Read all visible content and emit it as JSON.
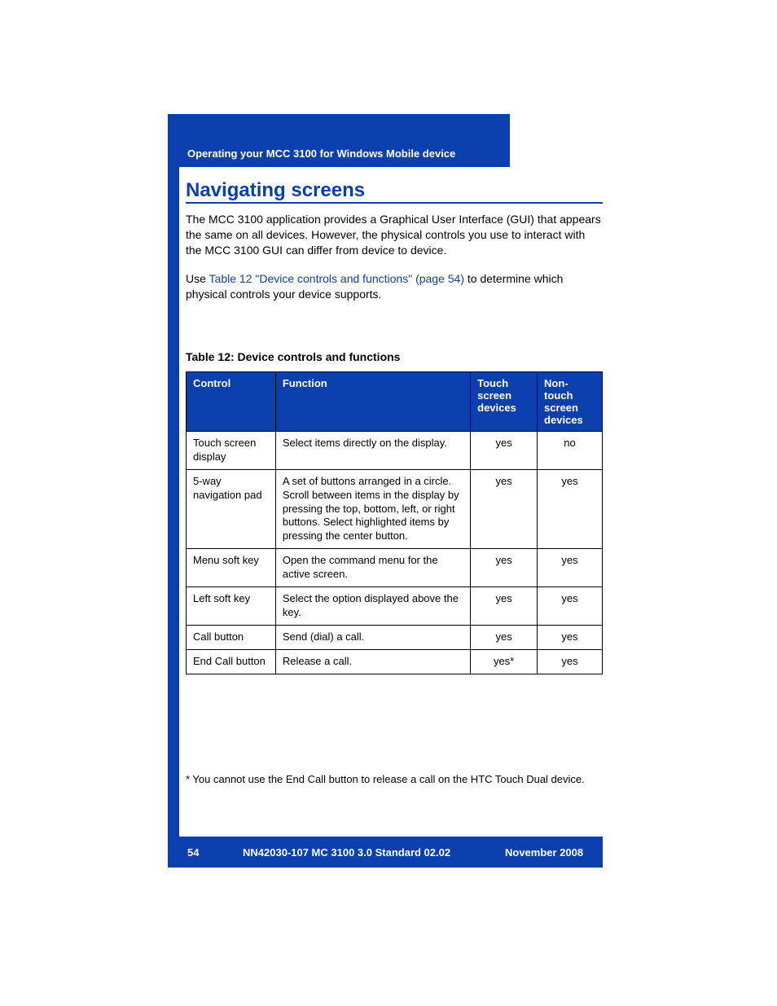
{
  "header": {
    "running_head": "Operating your MCC 3100 for Windows Mobile device"
  },
  "section": {
    "title": "Navigating screens"
  },
  "paragraphs": {
    "p1": "The MCC 3100 application provides a Graphical User Interface (GUI) that appears the same on all devices. However, the physical controls you use to interact with the MCC 3100 GUI can differ from device to device.",
    "p2_a": "Use ",
    "p2_link": "Table 12 \"Device controls and functions\" (page 54)",
    "p2_b": " to determine which physical controls your device supports."
  },
  "table": {
    "caption": "Table 12: Device controls and functions",
    "header": [
      "Control",
      "Function",
      "Touch screen devices",
      "Non-touch screen devices"
    ],
    "rows": [
      [
        "Touch screen display",
        "Select items directly on the display.",
        "yes",
        "no"
      ],
      [
        "5-way navigation pad",
        "A set of buttons arranged in a circle. Scroll between items in the display by pressing the top, bottom, left, or right buttons. Select highlighted items by pressing the center button.",
        "yes",
        "yes"
      ],
      [
        "Menu soft key",
        "Open the command menu for the active screen.",
        "yes",
        "yes"
      ],
      [
        "Left soft key",
        "Select the option displayed above the key.",
        "yes",
        "yes"
      ],
      [
        "Call button",
        "Send (dial) a call.",
        "yes",
        "yes"
      ],
      [
        "End Call button",
        "Release a call.",
        "yes*",
        "yes"
      ]
    ],
    "footnote": "* You cannot use the End Call button to release a call on the HTC Touch Dual device."
  },
  "footer": {
    "page": "54",
    "doc": "NN42030-107 MC 3100  3.0 Standard 02.02",
    "date": "November 2008"
  }
}
